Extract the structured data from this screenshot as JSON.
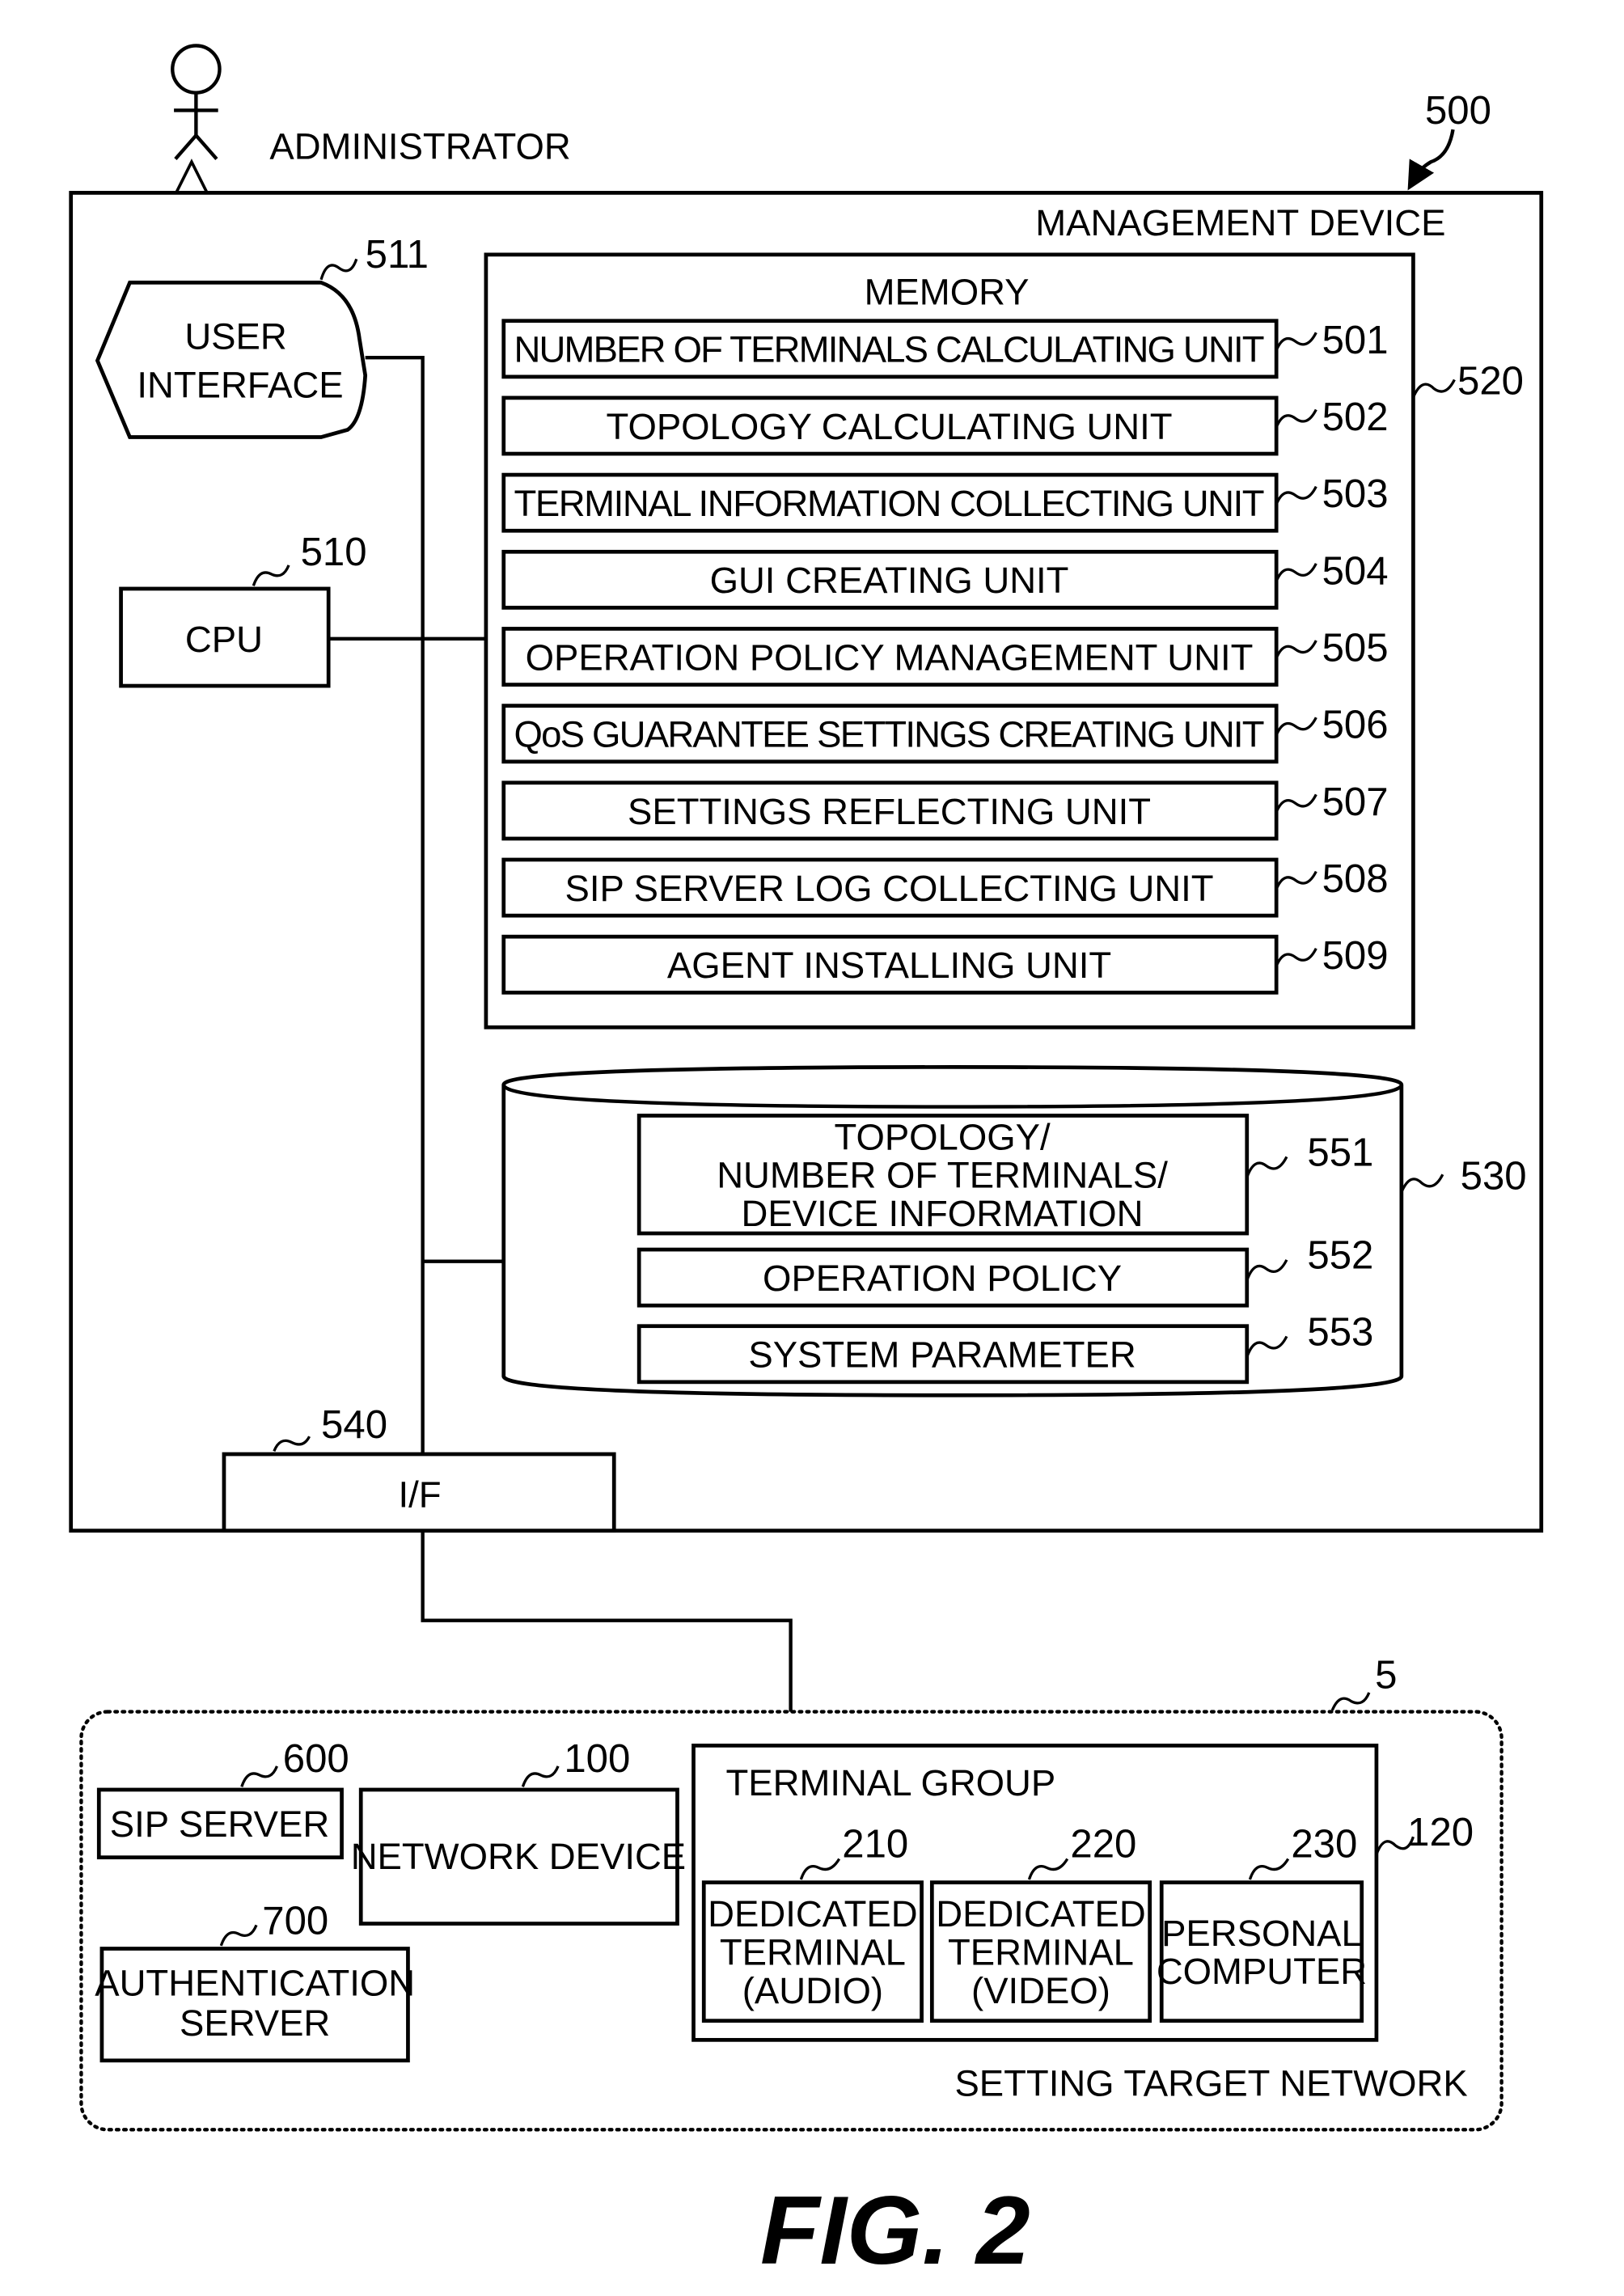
{
  "figure": {
    "caption": "FIG. 2"
  },
  "actor": {
    "label": "ADMINISTRATOR"
  },
  "management_device": {
    "label": "MANAGEMENT DEVICE",
    "ref": "500",
    "user_interface": {
      "line1": "USER",
      "line2": "INTERFACE",
      "ref": "511"
    },
    "cpu": {
      "label": "CPU",
      "ref": "510"
    },
    "interface": {
      "label": "I/F",
      "ref": "540"
    },
    "memory": {
      "label": "MEMORY",
      "ref": "520",
      "units": [
        {
          "label": "NUMBER OF TERMINALS CALCULATING UNIT",
          "ref": "501"
        },
        {
          "label": "TOPOLOGY CALCULATING UNIT",
          "ref": "502"
        },
        {
          "label": "TERMINAL INFORMATION COLLECTING UNIT",
          "ref": "503"
        },
        {
          "label": "GUI CREATING UNIT",
          "ref": "504"
        },
        {
          "label": "OPERATION POLICY MANAGEMENT UNIT",
          "ref": "505"
        },
        {
          "label": "QoS GUARANTEE SETTINGS CREATING UNIT",
          "ref": "506"
        },
        {
          "label": "SETTINGS REFLECTING UNIT",
          "ref": "507"
        },
        {
          "label": "SIP SERVER LOG COLLECTING UNIT",
          "ref": "508"
        },
        {
          "label": "AGENT INSTALLING UNIT",
          "ref": "509"
        }
      ]
    },
    "storage": {
      "ref": "530",
      "items": [
        {
          "lines": [
            "TOPOLOGY/",
            "NUMBER OF TERMINALS/",
            "DEVICE INFORMATION"
          ],
          "ref": "551"
        },
        {
          "lines": [
            "OPERATION POLICY"
          ],
          "ref": "552"
        },
        {
          "lines": [
            "SYSTEM PARAMETER"
          ],
          "ref": "553"
        }
      ]
    }
  },
  "network": {
    "label": "SETTING TARGET NETWORK",
    "ref": "5",
    "sip_server": {
      "label": "SIP SERVER",
      "ref": "600"
    },
    "auth_server": {
      "line1": "AUTHENTICATION",
      "line2": "SERVER",
      "ref": "700"
    },
    "network_device": {
      "label": "NETWORK DEVICE",
      "ref": "100"
    },
    "terminal_group": {
      "label": "TERMINAL GROUP",
      "ref": "120",
      "terminals": [
        {
          "lines": [
            "DEDICATED",
            "TERMINAL",
            "(AUDIO)"
          ],
          "ref": "210"
        },
        {
          "lines": [
            "DEDICATED",
            "TERMINAL",
            "(VIDEO)"
          ],
          "ref": "220"
        },
        {
          "lines": [
            "PERSONAL",
            "COMPUTER"
          ],
          "ref": "230"
        }
      ]
    }
  }
}
